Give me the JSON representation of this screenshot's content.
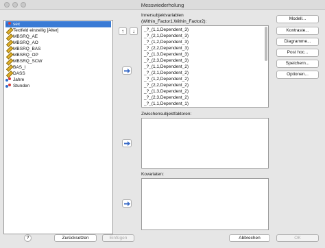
{
  "window": {
    "title": "Messwiederholung"
  },
  "variables": [
    {
      "label": "sex",
      "icon": "nominal-icon",
      "selected": true
    },
    {
      "label": "Textfeld einzeilig [Alter]",
      "icon": "pencil-icon"
    },
    {
      "label": "MBSRQ_AE",
      "icon": "pencil-icon"
    },
    {
      "label": "MBSRQ_AO",
      "icon": "pencil-icon"
    },
    {
      "label": "MBSRQ_BAS",
      "icon": "pencil-icon"
    },
    {
      "label": "MBSRQ_OP",
      "icon": "pencil-icon"
    },
    {
      "label": "MBSRQ_SCW",
      "icon": "pencil-icon"
    },
    {
      "label": "BAS_I",
      "icon": "pencil-icon"
    },
    {
      "label": "DASS",
      "icon": "pencil-icon"
    },
    {
      "label": "Jahre",
      "icon": "nominal-icon"
    },
    {
      "label": "Stunden",
      "icon": "nominal-icon"
    }
  ],
  "within": {
    "label_line1": "Innersubjektvariablen",
    "label_line2": "(Within_Factor1,Within_Factor2):",
    "items": [
      "_?_(1,1,Dependent_3)",
      "_?_(2,1,Dependent_3)",
      "_?_(1,2,Dependent_3)",
      "_?_(2,2,Dependent_3)",
      "_?_(1,3,Dependent_3)",
      "_?_(2,3,Dependent_3)",
      "_?_(1,1,Dependent_2)",
      "_?_(2,1,Dependent_2)",
      "_?_(1,2,Dependent_2)",
      "_?_(2,2,Dependent_2)",
      "_?_(1,3,Dependent_2)",
      "_?_(2,3,Dependent_2)",
      "_?_(1,1,Dependent_1)"
    ]
  },
  "between": {
    "label": "Zwischensubjektfaktoren:"
  },
  "covariates": {
    "label": "Kovariaten:"
  },
  "side_buttons": [
    "Modell...",
    "Kontraste...",
    "Diagramme...",
    "Post hoc...",
    "Speichern...",
    "Optionen..."
  ],
  "footer": {
    "help": "?",
    "reset": "Zurücksetzen",
    "paste": "Einfügen",
    "cancel": "Abbrechen",
    "ok": "OK"
  },
  "move_up_glyph": "↑",
  "move_down_glyph": "↓"
}
